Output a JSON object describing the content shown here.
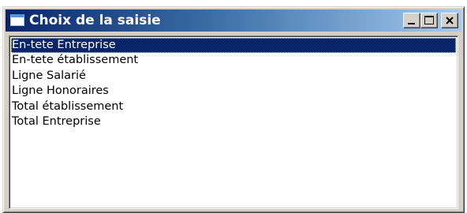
{
  "window": {
    "title": "Choix de la saisie",
    "controls": {
      "minimize": "minimize",
      "maximize": "maximize",
      "close": "close"
    }
  },
  "list": {
    "selected_index": 0,
    "items": [
      {
        "label": "En-tete Entreprise"
      },
      {
        "label": "En-tete établissement"
      },
      {
        "label": "Ligne Salarié"
      },
      {
        "label": "Ligne Honoraires"
      },
      {
        "label": "Total établissement"
      },
      {
        "label": "Total Entreprise"
      }
    ]
  },
  "colors": {
    "title_start": "#0a246a",
    "title_end": "#a6caf0",
    "selection": "#0a246a",
    "face": "#d4d0c8"
  }
}
